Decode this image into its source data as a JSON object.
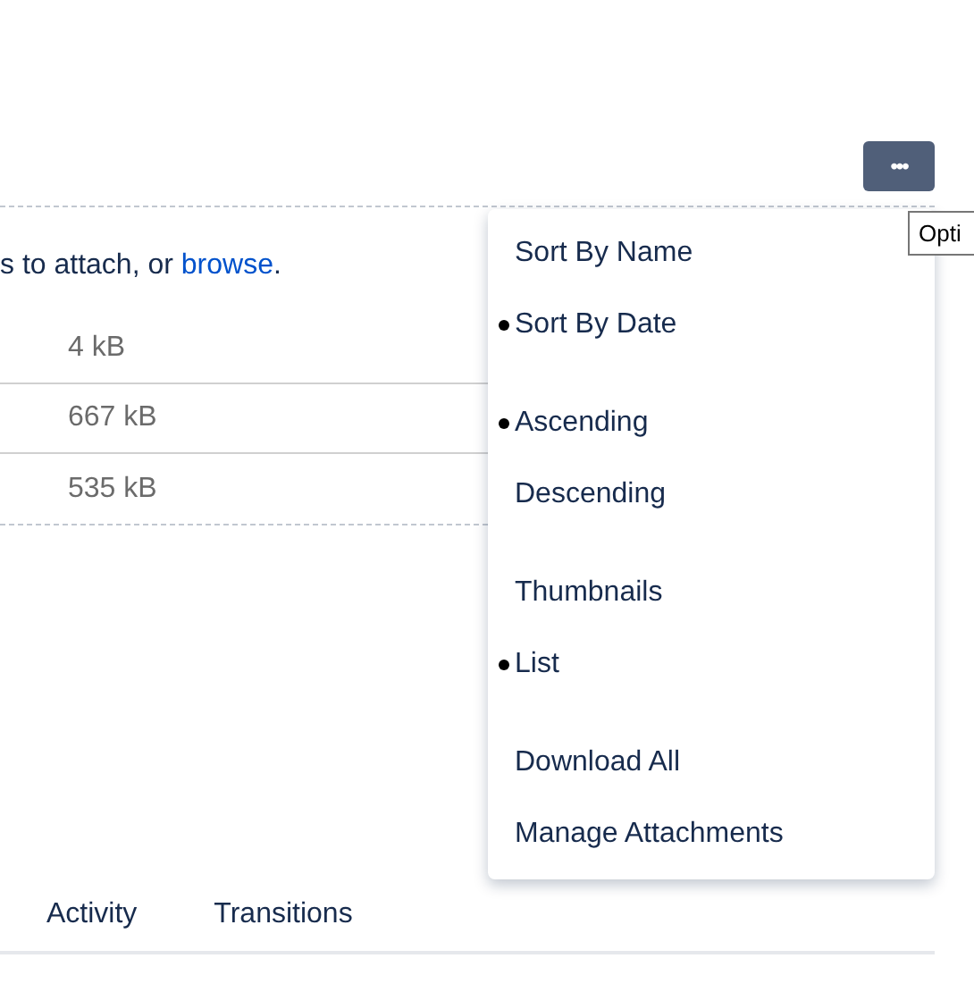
{
  "options_button": {
    "label": "•••"
  },
  "tooltip": {
    "text": "Opti"
  },
  "dropzone": {
    "text": "s to attach, or ",
    "link": "browse",
    "after": "."
  },
  "files": [
    {
      "size": "4 kB"
    },
    {
      "size": "667 kB"
    },
    {
      "size": "535 kB"
    }
  ],
  "menu": {
    "groups": [
      [
        {
          "label": "Sort By Name",
          "kind": "radio",
          "selected": false
        },
        {
          "label": "Sort By Date",
          "kind": "radio",
          "selected": true
        }
      ],
      [
        {
          "label": "Ascending",
          "kind": "radio",
          "selected": true
        },
        {
          "label": "Descending",
          "kind": "radio",
          "selected": false
        }
      ],
      [
        {
          "label": "Thumbnails",
          "kind": "radio",
          "selected": false
        },
        {
          "label": "List",
          "kind": "radio",
          "selected": true
        }
      ],
      [
        {
          "label": "Download All",
          "kind": "action"
        },
        {
          "label": "Manage Attachments",
          "kind": "action"
        }
      ]
    ]
  },
  "tabs": [
    {
      "label": "Activity"
    },
    {
      "label": "Transitions"
    }
  ]
}
